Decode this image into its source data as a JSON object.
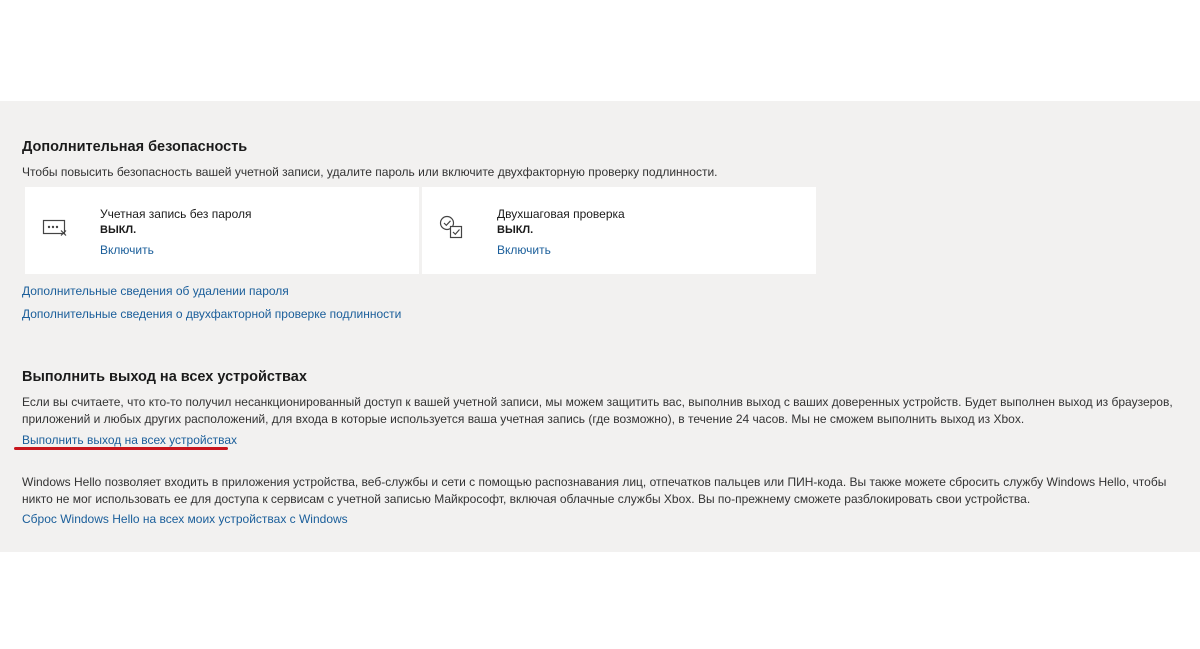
{
  "security": {
    "title": "Дополнительная безопасность",
    "description": "Чтобы повысить безопасность вашей учетной записи, удалите пароль или включите двухфакторную проверку подлинности.",
    "cards": [
      {
        "icon": "passwordless-icon",
        "title": "Учетная запись без пароля",
        "status": "ВЫКЛ.",
        "action": "Включить"
      },
      {
        "icon": "two-step-icon",
        "title": "Двухшаговая проверка",
        "status": "ВЫКЛ.",
        "action": "Включить"
      }
    ],
    "link_password_removal": "Дополнительные сведения об удалении пароля",
    "link_two_factor": "Дополнительные сведения о двухфакторной проверке подлинности"
  },
  "signout": {
    "title": "Выполнить выход на всех устройствах",
    "description": "Если вы считаете, что кто-то получил несанкционированный доступ к вашей учетной записи, мы можем защитить вас, выполнив выход с ваших доверенных устройств. Будет выполнен выход из браузеров, приложений и любых других расположений, для входа в которые используется ваша учетная запись (где возможно), в течение 24 часов. Мы не сможем выполнить выход из Xbox.",
    "link": "Выполнить выход на всех устройствах"
  },
  "hello": {
    "description": "Windows Hello позволяет входить в приложения устройства, веб-службы и сети с помощью распознавания лиц, отпечатков пальцев или ПИН-кода. Вы также можете сбросить службу Windows Hello, чтобы никто не мог использовать ее для доступа к сервисам с учетной записью Майкрософт, включая облачные службы Xbox. Вы по-прежнему сможете разблокировать свои устройства.",
    "link": "Сброс Windows Hello на всех моих устройствах с Windows"
  },
  "colors": {
    "panel_bg": "#f2f1f0",
    "link": "#1a5e9a",
    "highlight": "#c8161d"
  }
}
